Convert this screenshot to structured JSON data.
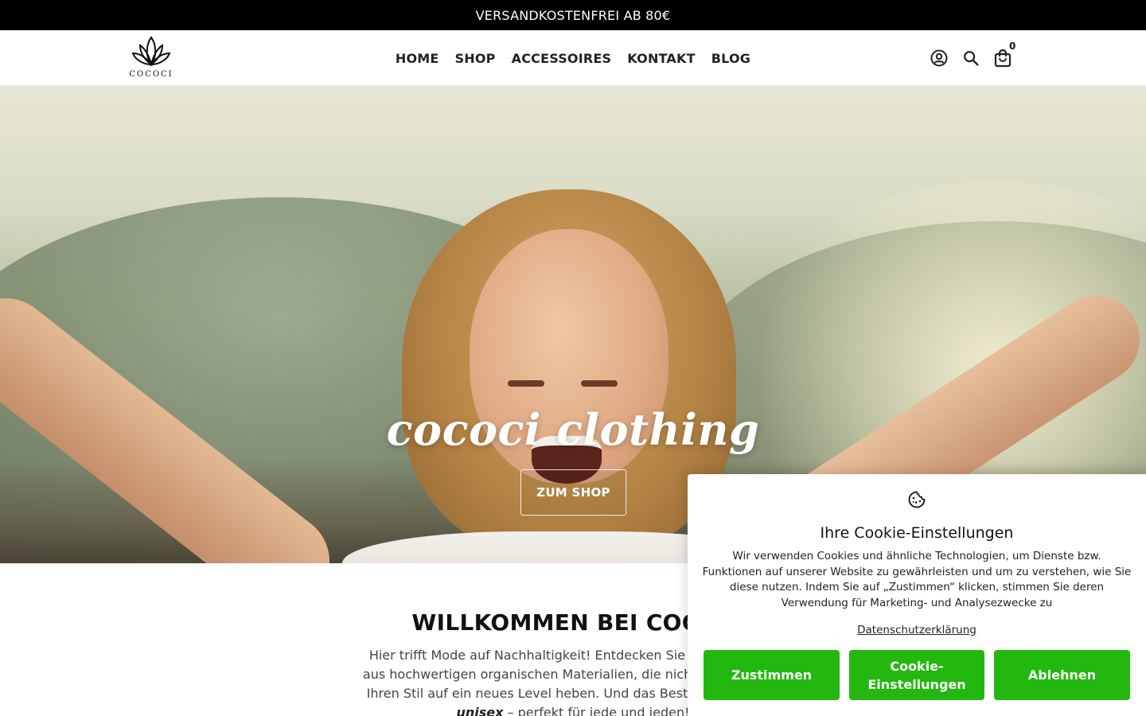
{
  "announcement": {
    "text": "VERSANDKOSTENFREI AB 80€"
  },
  "header": {
    "logo_text": "COCOCI",
    "nav": [
      "HOME",
      "SHOP",
      "ACCESSOIRES",
      "KONTAKT",
      "BLOG"
    ],
    "icons": [
      "account-icon",
      "search-icon",
      "cart-icon"
    ],
    "cart_count": "0"
  },
  "hero": {
    "title": "cococi clothing",
    "button_label": "ZUM SHOP"
  },
  "welcome": {
    "title": "WILLKOMMEN BEI COCOC",
    "lines": [
      "Hier trifft Mode auf Nachhaltigkeit! Entdecken Sie unsere handg",
      "aus hochwertigen organischen Materialien, die nicht nur umweltfr",
      "Ihren Stil auf ein neues Level heben. Und das Beste daran? Unse"
    ],
    "emphasis": "unisex",
    "last_line_rest": " – perfekt für jede und jeden!"
  },
  "cookie_banner": {
    "icon": "cookie-icon",
    "title": "Ihre Cookie-Einstellungen",
    "text": "Wir verwenden Cookies und ähnliche Technologien, um Dienste bzw. Funktionen auf unserer Website zu gewährleisten und um zu verstehen, wie Sie diese nutzen. Indem Sie auf „Zustimmen“ klicken, stimmen Sie deren Verwendung für Marketing- und Analysezwecke zu",
    "privacy_link": "Datenschutzerklärung",
    "buttons": {
      "accept": "Zustimmen",
      "settings": "Cookie-Einstellungen",
      "decline": "Ablehnen"
    },
    "button_color": "#22b80f"
  }
}
